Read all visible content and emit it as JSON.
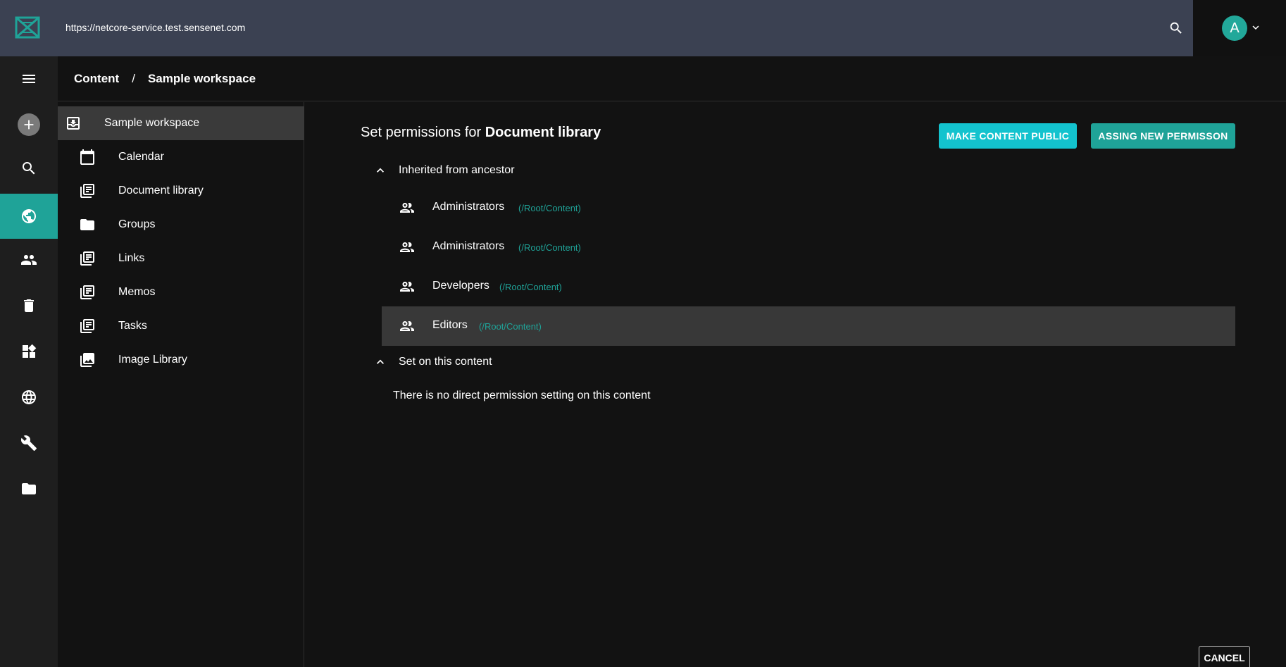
{
  "topbar": {
    "url": "https://netcore-service.test.sensenet.com",
    "avatar_letter": "A",
    "accent_color": "#1fa398",
    "bar_color": "#3b4152"
  },
  "rail": {
    "items": [
      {
        "name": "menu-icon"
      },
      {
        "name": "add-icon"
      },
      {
        "name": "search-icon"
      },
      {
        "name": "globe-icon",
        "active": true
      },
      {
        "name": "users-icon"
      },
      {
        "name": "trash-icon"
      },
      {
        "name": "dashboard-icon"
      },
      {
        "name": "localization-icon"
      },
      {
        "name": "wrench-icon"
      },
      {
        "name": "folder-icon"
      }
    ]
  },
  "breadcrumb": {
    "items": [
      "Content",
      "Sample workspace"
    ],
    "separator": "/"
  },
  "tree": {
    "root": "Sample workspace",
    "items": [
      {
        "label": "Calendar",
        "icon": "calendar-icon"
      },
      {
        "label": "Document library",
        "icon": "library-icon"
      },
      {
        "label": "Groups",
        "icon": "folder-icon"
      },
      {
        "label": "Links",
        "icon": "library-icon"
      },
      {
        "label": "Memos",
        "icon": "library-icon"
      },
      {
        "label": "Tasks",
        "icon": "library-icon"
      },
      {
        "label": "Image Library",
        "icon": "image-library-icon"
      }
    ]
  },
  "main": {
    "title_prefix": "Set permissions for",
    "title_target": "Document library",
    "make_public_label": "MAKE CONTENT PUBLIC",
    "assign_label": "ASSING NEW PERMISSON",
    "inherited_label": "Inherited from ancestor",
    "set_on_label": "Set on this content",
    "no_permission_text": "There is no direct permission setting on this content",
    "inherited": [
      {
        "name": "Administrators",
        "path": "(/Root/Content)"
      },
      {
        "name": "Administrators",
        "path": "(/Root/Content)"
      },
      {
        "name": "Developers",
        "path": "(/Root/Content)"
      },
      {
        "name": "Editors",
        "path": "(/Root/Content)",
        "selected": true
      }
    ],
    "cancel_label": "CANCEL"
  }
}
